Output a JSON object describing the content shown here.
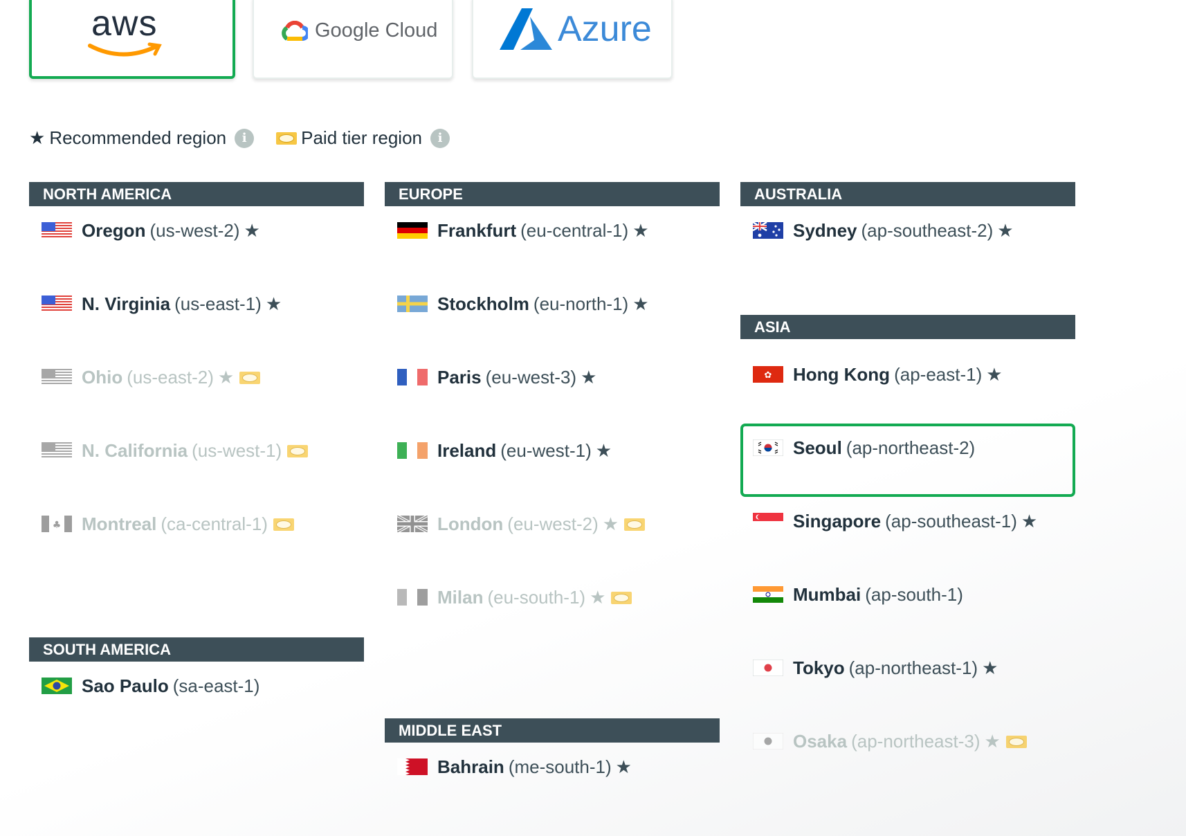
{
  "providers": {
    "aws": "aws",
    "gcp": "Google Cloud",
    "azure": "Azure",
    "selected": "aws"
  },
  "legend": {
    "recommended": "Recommended region",
    "paid": "Paid tier region"
  },
  "colors": {
    "accent": "#13aa52",
    "header_bg": "#3d4f58",
    "disabled_text": "#b8c4c2",
    "paid_icon": "#f7c744"
  },
  "sections": {
    "north_america": {
      "title": "NORTH AMERICA",
      "regions": [
        {
          "name": "Oregon",
          "code": "(us-west-2)",
          "star": "★",
          "flag": "us-flag-icon"
        },
        {
          "name": "N. Virginia",
          "code": "(us-east-1)",
          "star": "★",
          "flag": "us-flag-icon"
        },
        {
          "name": "Ohio",
          "code": "(us-east-2)",
          "star": "★",
          "flag": "us-flag-icon",
          "paid": true,
          "disabled": true
        },
        {
          "name": "N. California",
          "code": "(us-west-1)",
          "flag": "us-flag-icon",
          "paid": true,
          "disabled": true
        },
        {
          "name": "Montreal",
          "code": "(ca-central-1)",
          "flag": "canada-flag-icon",
          "paid": true,
          "disabled": true
        }
      ]
    },
    "south_america": {
      "title": "SOUTH AMERICA",
      "regions": [
        {
          "name": "Sao Paulo",
          "code": "(sa-east-1)",
          "flag": "brazil-flag-icon"
        }
      ]
    },
    "europe": {
      "title": "EUROPE",
      "regions": [
        {
          "name": "Frankfurt",
          "code": "(eu-central-1)",
          "star": "★",
          "flag": "germany-flag-icon"
        },
        {
          "name": "Stockholm",
          "code": "(eu-north-1)",
          "star": "★",
          "flag": "sweden-flag-icon"
        },
        {
          "name": "Paris",
          "code": "(eu-west-3)",
          "star": "★",
          "flag": "france-flag-icon"
        },
        {
          "name": "Ireland",
          "code": "(eu-west-1)",
          "star": "★",
          "flag": "ireland-flag-icon"
        },
        {
          "name": "London",
          "code": "(eu-west-2)",
          "star": "★",
          "flag": "uk-flag-icon",
          "paid": true,
          "disabled": true
        },
        {
          "name": "Milan",
          "code": "(eu-south-1)",
          "star": "★",
          "flag": "italy-flag-icon",
          "paid": true,
          "disabled": true
        }
      ]
    },
    "middle_east": {
      "title": "MIDDLE EAST",
      "regions": [
        {
          "name": "Bahrain",
          "code": "(me-south-1)",
          "star": "★",
          "flag": "bahrain-flag-icon"
        }
      ]
    },
    "australia": {
      "title": "AUSTRALIA",
      "regions": [
        {
          "name": "Sydney",
          "code": "(ap-southeast-2)",
          "star": "★",
          "flag": "australia-flag-icon"
        }
      ]
    },
    "asia": {
      "title": "ASIA",
      "regions": [
        {
          "name": "Hong Kong",
          "code": "(ap-east-1)",
          "star": "★",
          "flag": "hongkong-flag-icon"
        },
        {
          "name": "Seoul",
          "code": "(ap-northeast-2)",
          "flag": "korea-flag-icon",
          "selected": true
        },
        {
          "name": "Singapore",
          "code": "(ap-southeast-1)",
          "star": "★",
          "flag": "singapore-flag-icon"
        },
        {
          "name": "Mumbai",
          "code": "(ap-south-1)",
          "flag": "india-flag-icon"
        },
        {
          "name": "Tokyo",
          "code": "(ap-northeast-1)",
          "star": "★",
          "flag": "japan-flag-icon"
        },
        {
          "name": "Osaka",
          "code": "(ap-northeast-3)",
          "star": "★",
          "flag": "japan-flag-icon",
          "paid": true,
          "disabled": true
        }
      ]
    }
  }
}
